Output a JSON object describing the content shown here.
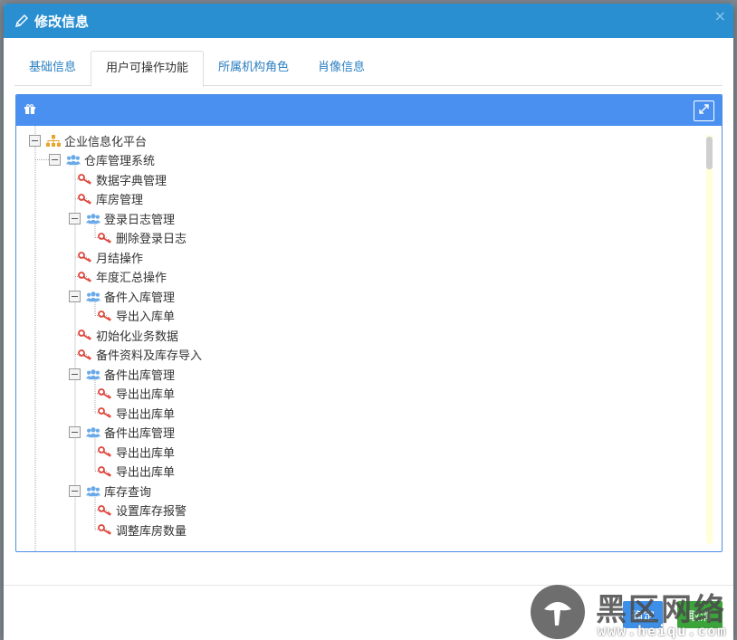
{
  "modal": {
    "title": "修改信息",
    "close_symbol": "×"
  },
  "tabs": [
    {
      "label": "基础信息",
      "active": false
    },
    {
      "label": "用户可操作功能",
      "active": true
    },
    {
      "label": "所属机构角色",
      "active": false
    },
    {
      "label": "肖像信息",
      "active": false
    }
  ],
  "icons": {
    "title": "pencil-icon",
    "panel": "gift-icon",
    "expand": "expand-icon",
    "org": "org-chart-icon",
    "group": "users-icon",
    "leaf": "key-icon"
  },
  "colors": {
    "header": "#2a8fd0",
    "panel_header": "#4a90f0",
    "key": "#e0453a",
    "group": "#6aaae8",
    "org": "#e8a32a",
    "ok_button": "#3d8fe8",
    "cancel_button": "#3aa43a"
  },
  "tree": {
    "root": "企业信息化平台",
    "system": "仓库管理系统",
    "items": [
      {
        "type": "leaf",
        "label": "数据字典管理"
      },
      {
        "type": "leaf",
        "label": "库房管理"
      },
      {
        "type": "group",
        "label": "登录日志管理",
        "children": [
          "删除登录日志"
        ]
      },
      {
        "type": "leaf",
        "label": "月结操作"
      },
      {
        "type": "leaf",
        "label": "年度汇总操作"
      },
      {
        "type": "group",
        "label": "备件入库管理",
        "children": [
          "导出入库单"
        ]
      },
      {
        "type": "leaf",
        "label": "初始化业务数据"
      },
      {
        "type": "leaf",
        "label": "备件资料及库存导入"
      },
      {
        "type": "group",
        "label": "备件出库管理",
        "children": [
          "导出出库单",
          "导出出库单"
        ]
      },
      {
        "type": "group",
        "label": "备件出库管理",
        "children": [
          "导出出库单",
          "导出出库单"
        ]
      },
      {
        "type": "group",
        "label": "库存查询",
        "children": [
          "设置库存报警",
          "调整库房数量"
        ]
      }
    ]
  },
  "buttons": {
    "ok": "确定",
    "cancel": "取消"
  },
  "watermark": {
    "title": "黑区网络",
    "url": "www.heiqu.com"
  }
}
